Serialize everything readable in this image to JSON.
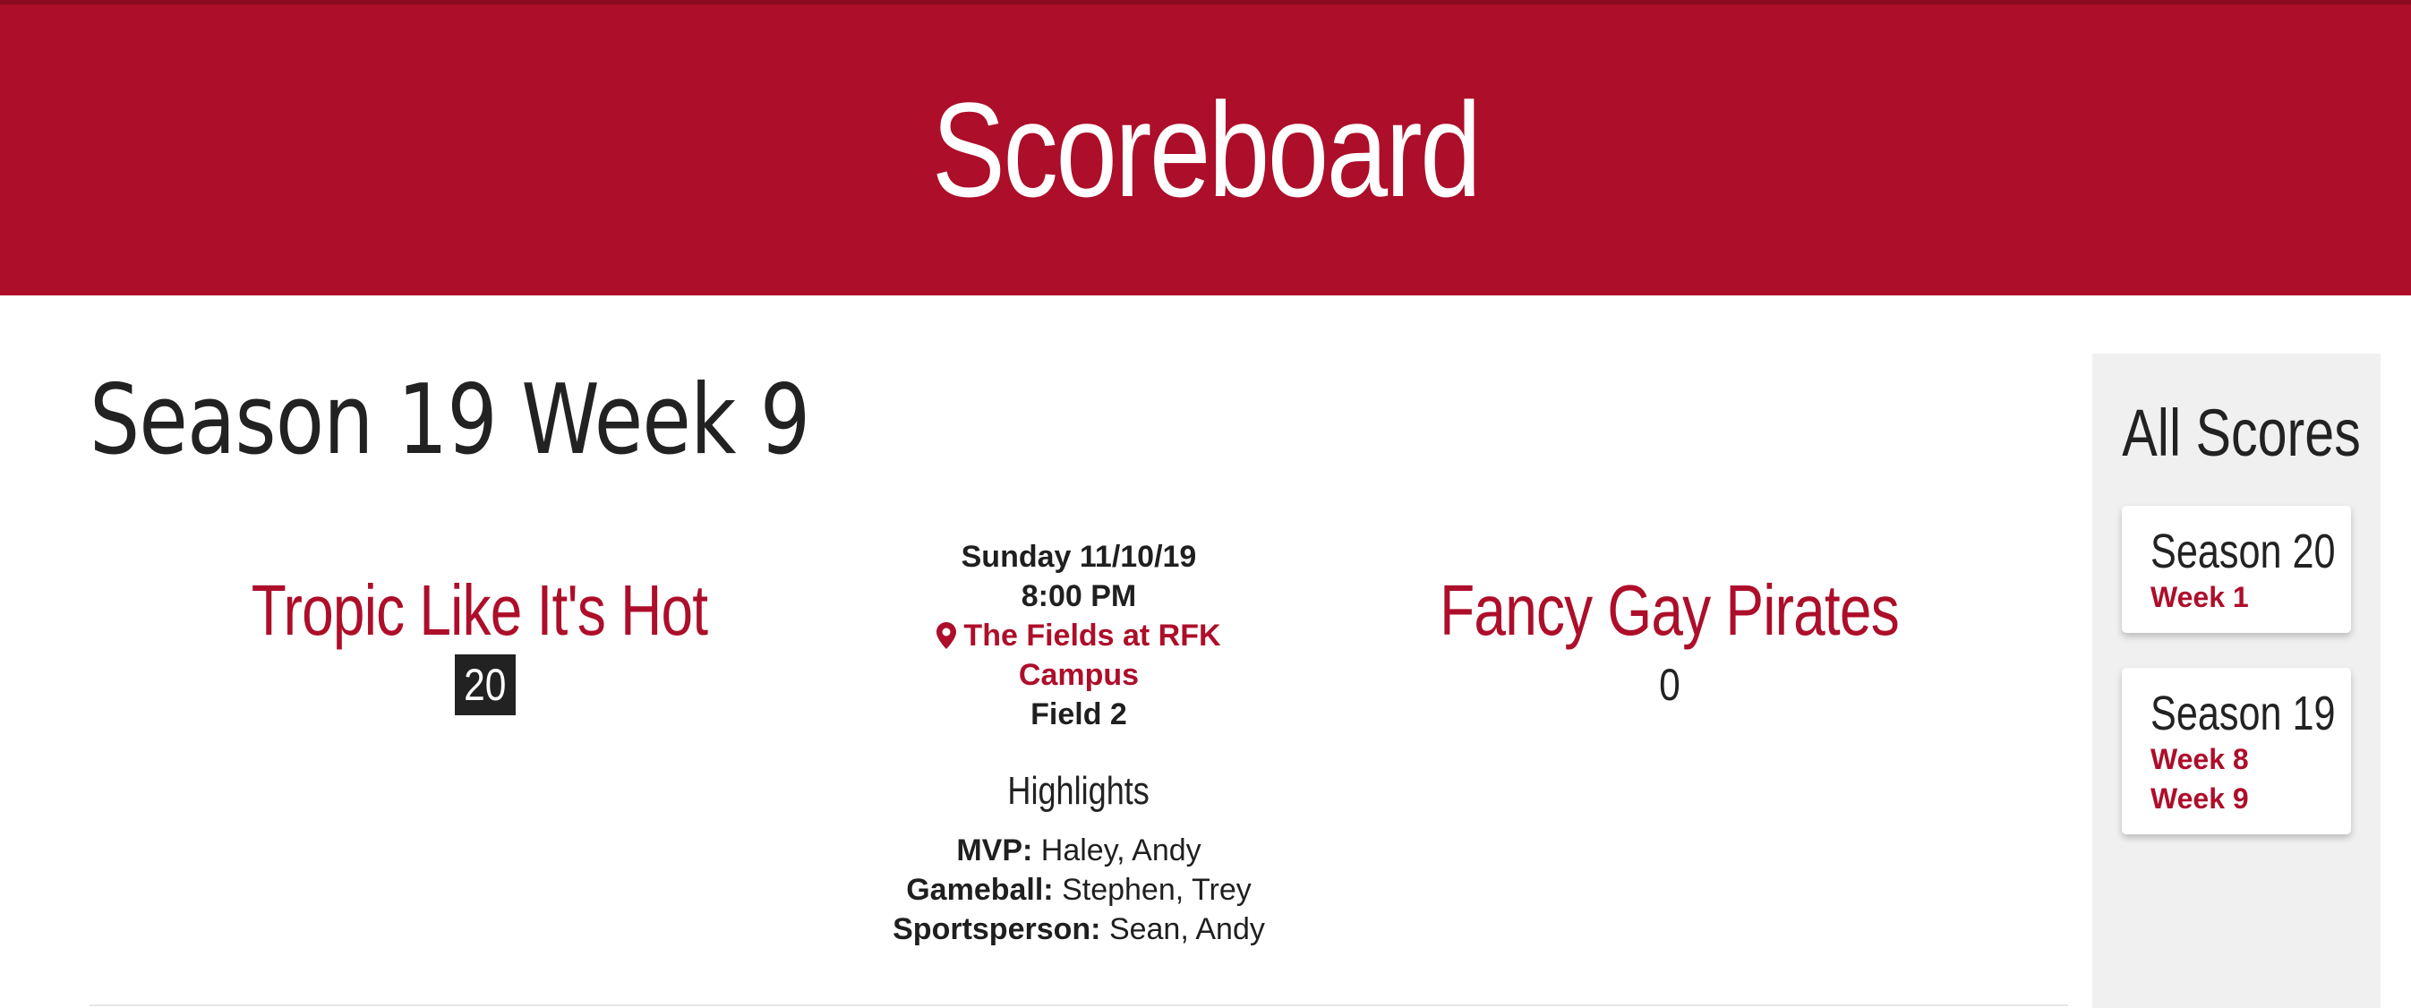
{
  "header": {
    "title": "Scoreboard"
  },
  "main": {
    "week_title": "Season 19 Week 9",
    "game": {
      "home_team": "Tropic Like It's Hot",
      "home_score": "20",
      "away_team": "Fancy Gay Pirates",
      "away_score": "0",
      "date": "Sunday 11/10/19",
      "time": "8:00 PM",
      "location": "The Fields at RFK Campus",
      "field": "Field 2",
      "highlights_title": "Highlights",
      "highlights": [
        {
          "label": "MVP:",
          "value": "Haley, Andy"
        },
        {
          "label": "Gameball:",
          "value": "Stephen, Trey"
        },
        {
          "label": "Sportsperson:",
          "value": "Sean, Andy"
        }
      ]
    }
  },
  "sidebar": {
    "title": "All Scores",
    "seasons": [
      {
        "name": "Season 20",
        "weeks": [
          "Week 1"
        ]
      },
      {
        "name": "Season 19",
        "weeks": [
          "Week 8",
          "Week 9"
        ]
      }
    ]
  },
  "colors": {
    "brand": "#ad0e2a",
    "text": "#222222",
    "sidebar_bg": "#f0f0f0"
  },
  "icons": {
    "location": "map-pin-icon"
  }
}
